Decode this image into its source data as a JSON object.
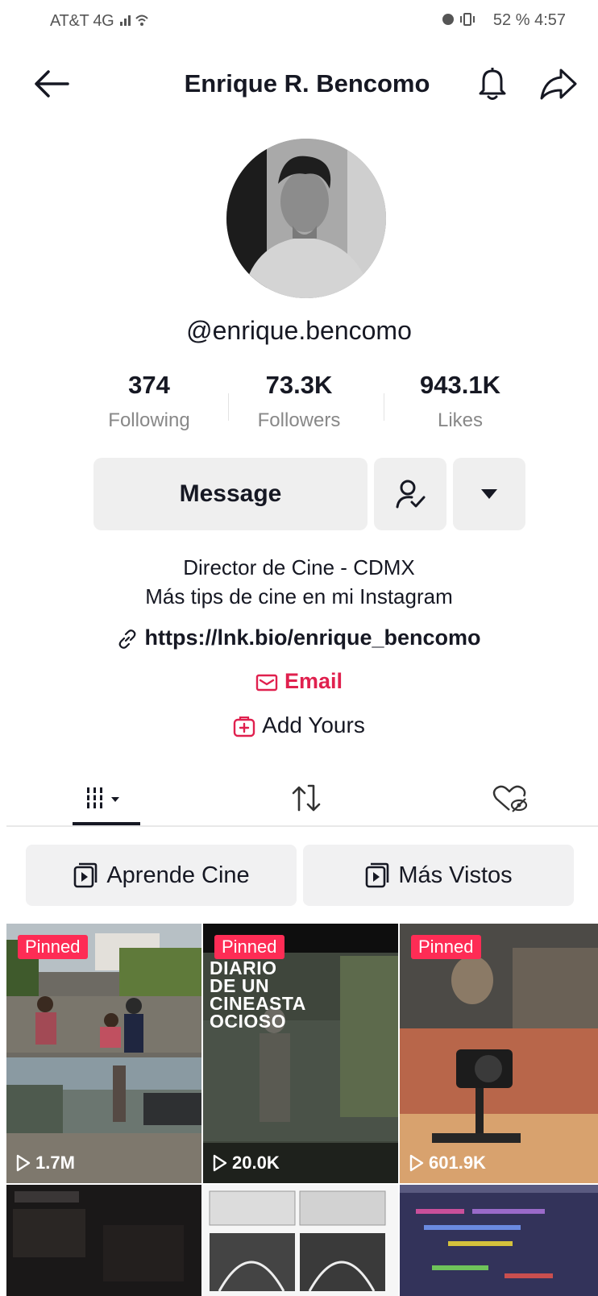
{
  "status_bar": {
    "left": "AT&T 4G",
    "right": "52 %   4:57"
  },
  "header": {
    "title": "Enrique R. Bencomo",
    "back_icon": "arrow-left-icon",
    "bell_icon": "bell-icon",
    "share_icon": "share-arrow-icon"
  },
  "profile": {
    "username": "@enrique.bencomo",
    "stats": [
      {
        "value": "374",
        "label": "Following"
      },
      {
        "value": "73.3K",
        "label": "Followers"
      },
      {
        "value": "943.1K",
        "label": "Likes"
      }
    ],
    "message_label": "Message",
    "bio_line1": "Director de Cine - CDMX",
    "bio_line2": "Más tips de cine en mi Instagram",
    "link": "https://lnk.bio/enrique_bencomo",
    "email_label": "Email",
    "add_yours_label": "Add Yours"
  },
  "playlists": [
    {
      "label": "Aprende Cine"
    },
    {
      "label": "Más Vistos"
    }
  ],
  "videos": [
    {
      "pinned": "Pinned",
      "views": "1.7M",
      "overlay": ""
    },
    {
      "pinned": "Pinned",
      "views": "20.0K",
      "overlay_lines": [
        "DIARIO",
        "DE UN",
        "CINEASTA",
        "OCIOSO"
      ]
    },
    {
      "pinned": "Pinned",
      "views": "601.9K",
      "overlay": ""
    }
  ],
  "colors": {
    "accent": "#fe2c55",
    "email": "#e0204e",
    "button_bg": "#efefef"
  }
}
